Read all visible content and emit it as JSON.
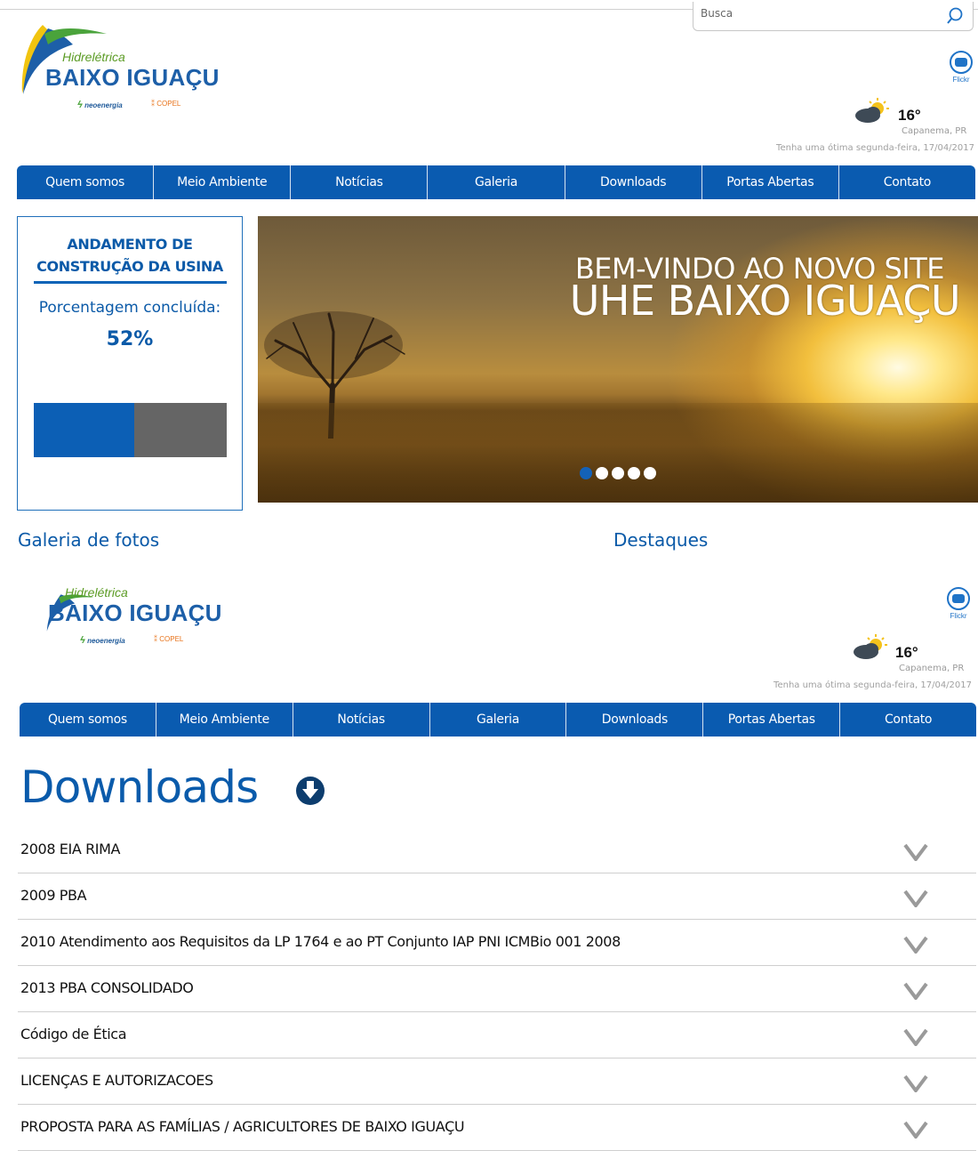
{
  "search": {
    "placeholder": "Busca"
  },
  "logo": {
    "small": "Hidrelétrica",
    "big": "BAIXO IGUAÇU",
    "partner1": "neoenergia",
    "partner2": "COPEL"
  },
  "social": {
    "flickr_label": "Flickr"
  },
  "weather": {
    "temp": "16°",
    "city": "Capanema, PR",
    "greeting": "Tenha uma ótima segunda-feira, 17/04/2017",
    "icon": "partly-cloudy-icon"
  },
  "nav": [
    "Quem somos",
    "Meio Ambiente",
    "Notícias",
    "Galeria",
    "Downloads",
    "Portas Abertas",
    "Contato"
  ],
  "progress": {
    "title_line1": "ANDAMENTO DE",
    "title_line2": "CONSTRUÇÃO DA USINA",
    "label": "Porcentagem concluída:",
    "value_text": "52%",
    "fraction": 0.52
  },
  "slider": {
    "line1": "BEM-VINDO AO NOVO SITE",
    "line2": "UHE BAIXO IGUAÇU",
    "dot_count": 5,
    "active_dot": 0
  },
  "sections": {
    "gallery": "Galeria de fotos",
    "highlights": "Destaques"
  },
  "downloads": {
    "title": "Downloads",
    "items": [
      "2008 EIA RIMA",
      "2009 PBA",
      "2010 Atendimento aos Requisitos da LP 1764 e ao PT Conjunto IAP PNI ICMBio 001 2008",
      "2013 PBA CONSOLIDADO",
      "Código de Ética",
      "LICENÇAS E AUTORIZACOES",
      "PROPOSTA PARA AS FAMÍLIAS / AGRICULTORES DE BAIXO IGUAÇU"
    ]
  },
  "colors": {
    "brand_blue": "#0a5bb0",
    "accent_green": "#5b9b24"
  }
}
